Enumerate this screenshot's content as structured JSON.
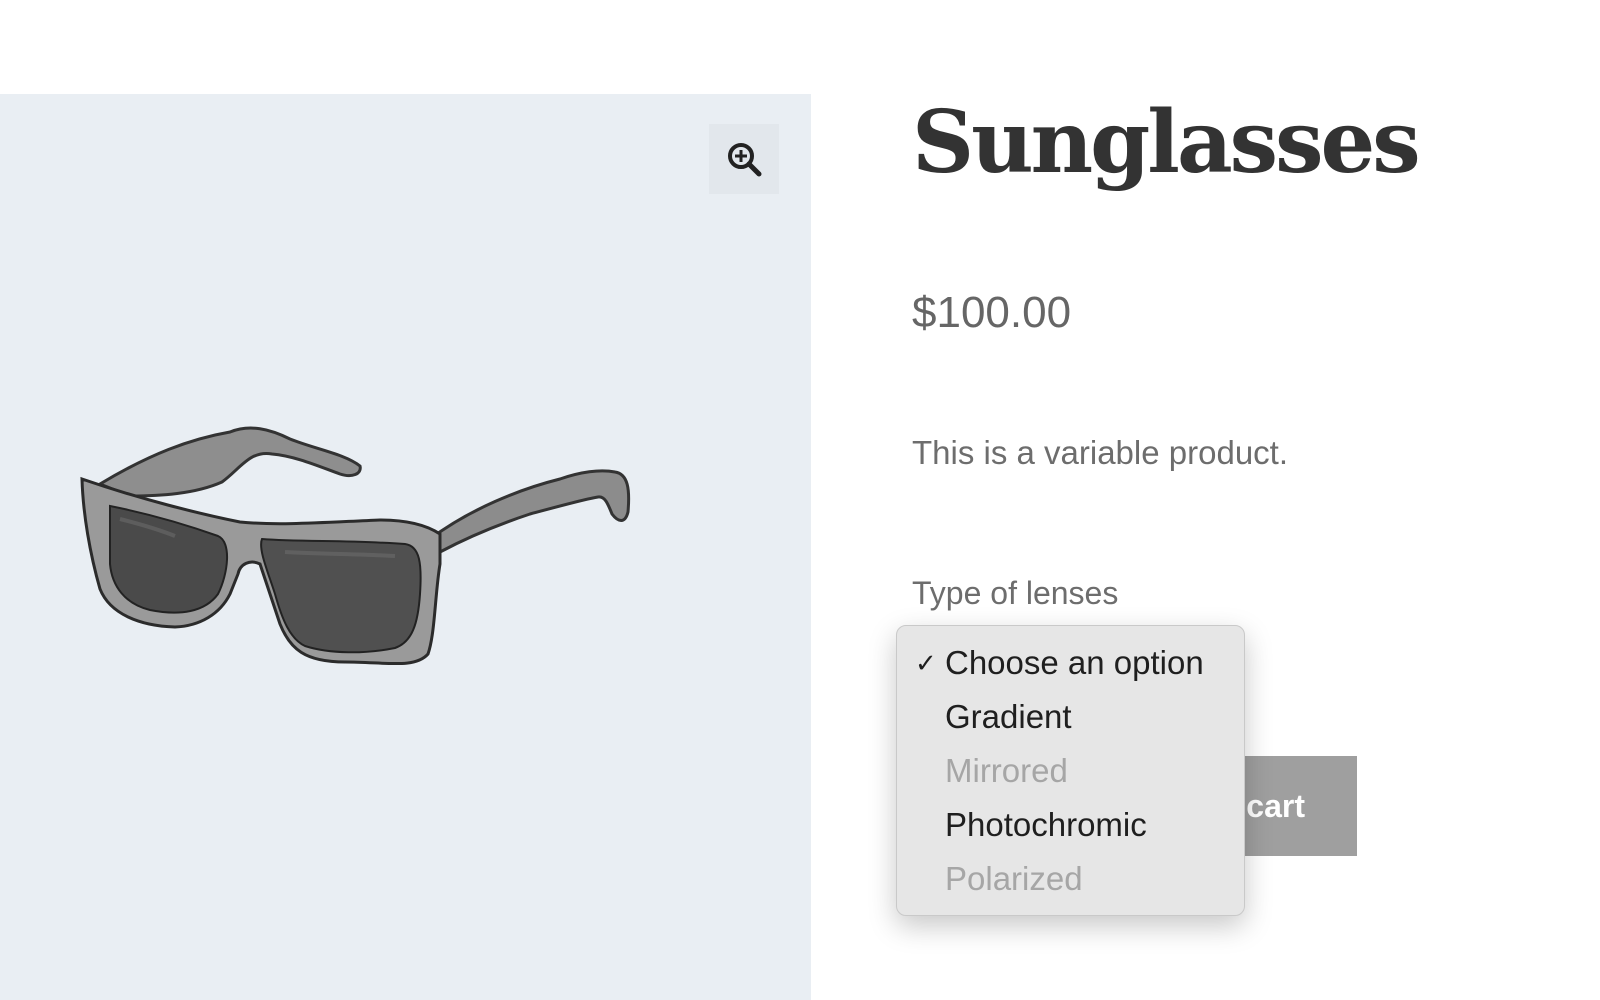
{
  "product": {
    "title": "Sunglasses",
    "price": "$100.00",
    "description": "This is a variable product."
  },
  "variation": {
    "label": "Type of lenses",
    "options": [
      {
        "label": "Choose an option",
        "selected": true,
        "disabled": false
      },
      {
        "label": "Gradient",
        "selected": false,
        "disabled": false
      },
      {
        "label": "Mirrored",
        "selected": false,
        "disabled": true
      },
      {
        "label": "Photochromic",
        "selected": false,
        "disabled": false
      },
      {
        "label": "Polarized",
        "selected": false,
        "disabled": true
      }
    ],
    "check_glyph": "✓"
  },
  "actions": {
    "add_to_cart_visible": "cart"
  },
  "gallery": {
    "zoom_icon": "zoom-in-icon",
    "image": "sunglasses-illustration"
  },
  "colors": {
    "gallery_bg": "#e9eef3",
    "button_bg": "#9f9f9f",
    "text_muted": "#6d6d6d"
  }
}
